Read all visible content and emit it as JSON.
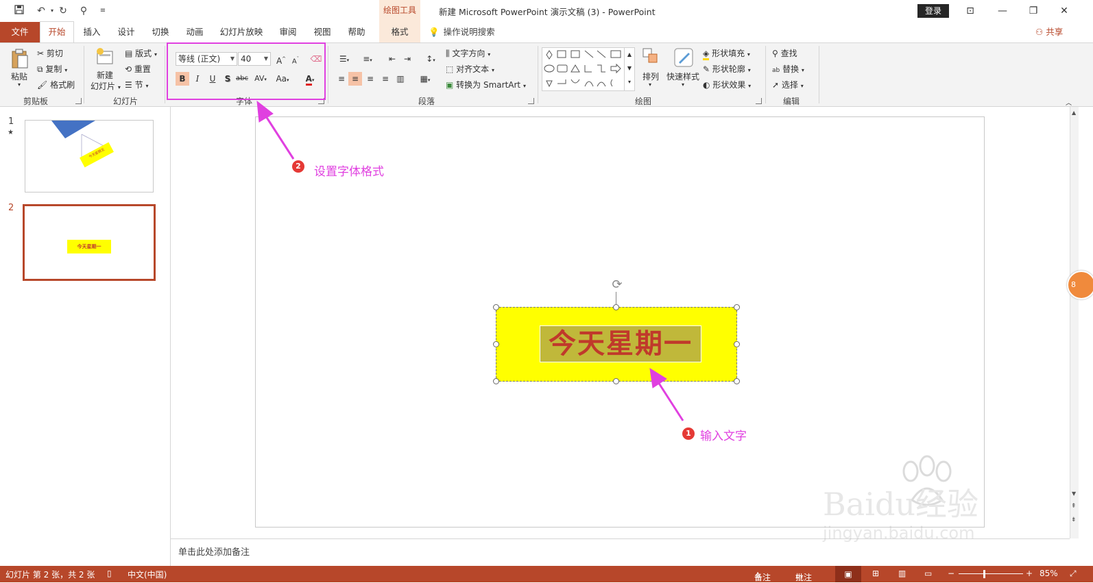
{
  "app": {
    "contextual_tab_group": "绘图工具",
    "window_title": "新建 Microsoft PowerPoint 演示文稿 (3)  -  PowerPoint",
    "login": "登录",
    "share": "共享"
  },
  "tabs": {
    "file": "文件",
    "items": [
      "开始",
      "插入",
      "设计",
      "切换",
      "动画",
      "幻灯片放映",
      "审阅",
      "视图",
      "帮助",
      "格式"
    ],
    "tell_me": "操作说明搜索"
  },
  "ribbon": {
    "clipboard": {
      "paste": "粘贴",
      "cut": "剪切",
      "copy": "复制",
      "format_painter": "格式刷",
      "label": "剪贴板"
    },
    "slides": {
      "new_slide_1": "新建",
      "new_slide_2": "幻灯片",
      "layout": "版式",
      "reset": "重置",
      "section": "节",
      "label": "幻灯片"
    },
    "font": {
      "font_name": "等线 (正文)",
      "font_size": "40",
      "label": "字体",
      "case": "Aa",
      "spacing": "AV",
      "strike": "abc"
    },
    "paragraph": {
      "text_direction": "文字方向",
      "align_text": "对齐文本",
      "smartart": "转换为 SmartArt",
      "label": "段落"
    },
    "drawing": {
      "arrange": "排列",
      "quick_styles": "快速样式",
      "shape_fill": "形状填充",
      "shape_outline": "形状轮廓",
      "shape_effects": "形状效果",
      "label": "绘图"
    },
    "editing": {
      "find": "查找",
      "replace": "替换",
      "select": "选择",
      "label": "编辑"
    }
  },
  "slides_panel": {
    "slides": [
      {
        "number": "1",
        "marker": "★",
        "text": "今天星期五"
      },
      {
        "number": "2",
        "marker": "",
        "text": "今天星期一"
      }
    ]
  },
  "slide": {
    "textbox_text": "今天星期一"
  },
  "annotations": {
    "step1_num": "1",
    "step1_label": "输入文字",
    "step2_num": "2",
    "step2_label": "设置字体格式"
  },
  "notes": {
    "placeholder": "单击此处添加备注"
  },
  "statusbar": {
    "slide_info": "幻灯片 第 2 张，共 2 张",
    "language": "中文(中国)",
    "notes": "备注",
    "comments": "批注",
    "zoom": "85%"
  },
  "side_badge": "8",
  "watermark": {
    "brand": "Baidu经验",
    "url": "jingyan.baidu.com"
  },
  "colors": {
    "accent": "#b7472a",
    "highlight": "#e040e0",
    "shape_fill": "#ffff00",
    "text_color": "#c0392b"
  }
}
